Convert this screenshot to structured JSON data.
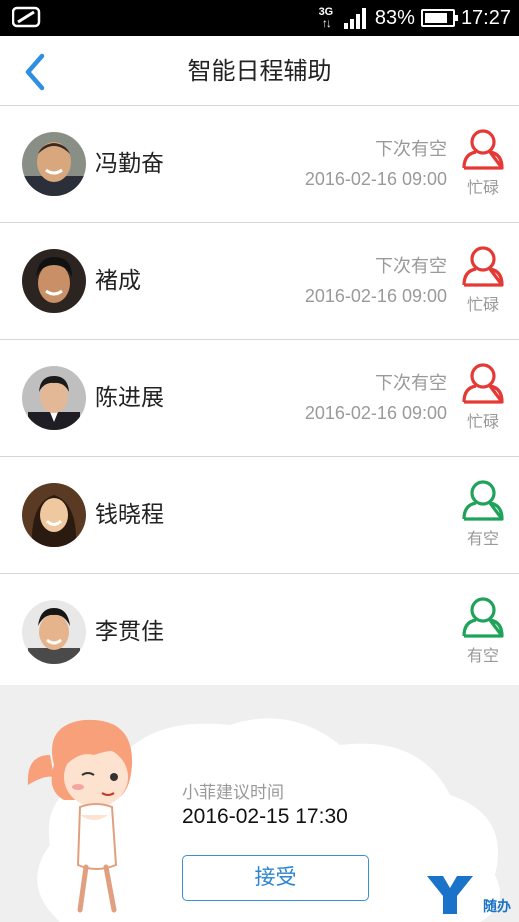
{
  "status_bar": {
    "network": "3G",
    "battery": "83%",
    "battery_level": 0.83,
    "time": "17:27"
  },
  "header": {
    "title": "智能日程辅助"
  },
  "people": [
    {
      "name": "冯勤奋",
      "next_label": "下次有空",
      "next_time": "2016-02-16 09:00",
      "status": "忙碌",
      "status_color": "#e53935"
    },
    {
      "name": "褚成",
      "next_label": "下次有空",
      "next_time": "2016-02-16 09:00",
      "status": "忙碌",
      "status_color": "#e53935"
    },
    {
      "name": "陈进展",
      "next_label": "下次有空",
      "next_time": "2016-02-16 09:00",
      "status": "忙碌",
      "status_color": "#e53935"
    },
    {
      "name": "钱晓程",
      "next_label": "",
      "next_time": "",
      "status": "有空",
      "status_color": "#1fa35a"
    },
    {
      "name": "李贯佳",
      "next_label": "",
      "next_time": "",
      "status": "有空",
      "status_color": "#1fa35a"
    }
  ],
  "suggestion": {
    "label": "小菲建议时间",
    "time": "2016-02-15 17:30",
    "accept_label": "接受"
  },
  "brand": {
    "logo_text": "随办",
    "accent": "#2b84cf"
  }
}
